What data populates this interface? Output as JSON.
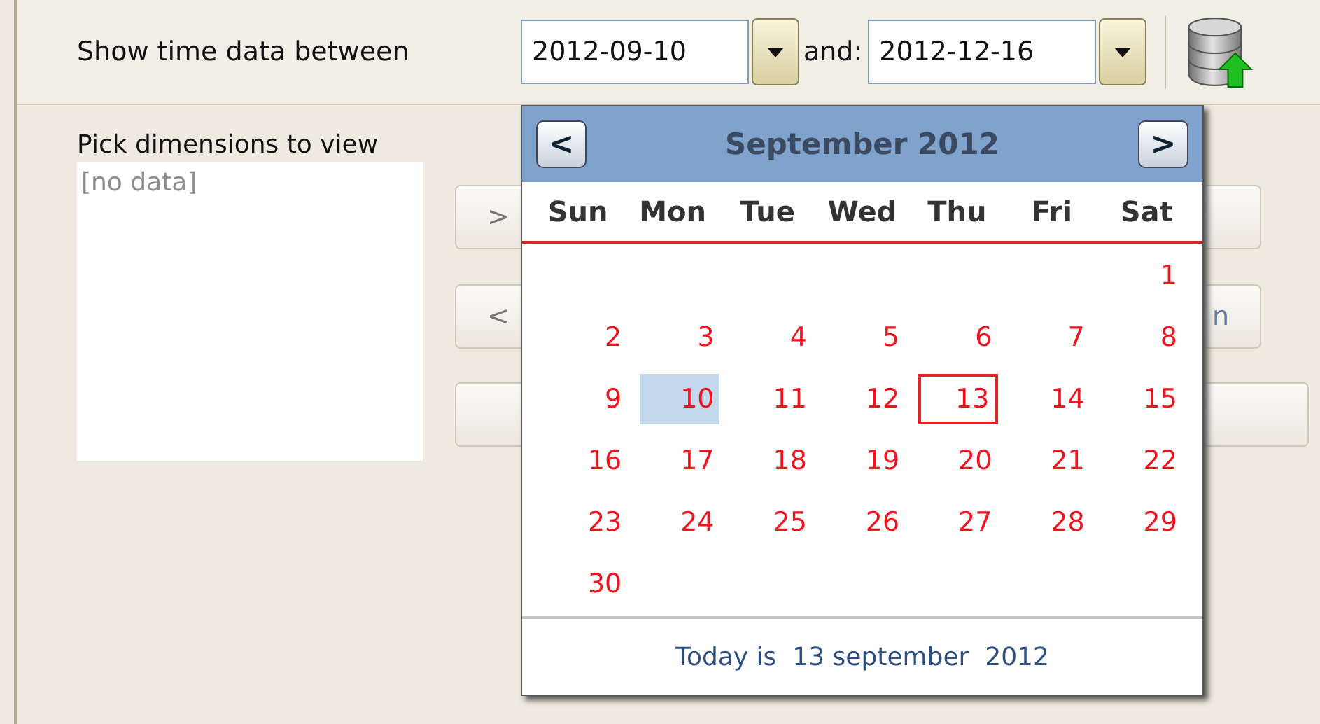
{
  "toolbar": {
    "label": "Show time data between",
    "start_date": {
      "value": "2012-09-10"
    },
    "separator": "and:",
    "end_date": {
      "value": "2012-12-16"
    }
  },
  "dimensions": {
    "label": "Pick dimensions to view",
    "list_placeholder": "[no data]"
  },
  "buttons": [
    {
      "kind": "standard",
      "label": ">"
    },
    {
      "kind": "standard",
      "label": "<",
      "trailing": "n"
    },
    {
      "kind": "shifted"
    }
  ],
  "calendar": {
    "title": "September 2012",
    "prev": "<",
    "next": ">",
    "weekdays": [
      "Sun",
      "Mon",
      "Tue",
      "Wed",
      "Thu",
      "Fri",
      "Sat"
    ],
    "weeks": [
      [
        {
          "kind": "blank"
        },
        {
          "kind": "blank"
        },
        {
          "kind": "blank"
        },
        {
          "kind": "blank"
        },
        {
          "kind": "blank"
        },
        {
          "kind": "blank"
        },
        {
          "kind": "day",
          "day": "1",
          "selected": false,
          "today": false
        }
      ],
      [
        {
          "kind": "day",
          "day": "2",
          "selected": false,
          "today": false
        },
        {
          "kind": "day",
          "day": "3",
          "selected": false,
          "today": false
        },
        {
          "kind": "day",
          "day": "4",
          "selected": false,
          "today": false
        },
        {
          "kind": "day",
          "day": "5",
          "selected": false,
          "today": false
        },
        {
          "kind": "day",
          "day": "6",
          "selected": false,
          "today": false
        },
        {
          "kind": "day",
          "day": "7",
          "selected": false,
          "today": false
        },
        {
          "kind": "day",
          "day": "8",
          "selected": false,
          "today": false
        }
      ],
      [
        {
          "kind": "day",
          "day": "9",
          "selected": false,
          "today": false
        },
        {
          "kind": "day",
          "day": "10",
          "selected": true,
          "today": false
        },
        {
          "kind": "day",
          "day": "11",
          "selected": false,
          "today": false
        },
        {
          "kind": "day",
          "day": "12",
          "selected": false,
          "today": false
        },
        {
          "kind": "day",
          "day": "13",
          "selected": false,
          "today": true
        },
        {
          "kind": "day",
          "day": "14",
          "selected": false,
          "today": false
        },
        {
          "kind": "day",
          "day": "15",
          "selected": false,
          "today": false
        }
      ],
      [
        {
          "kind": "day",
          "day": "16",
          "selected": false,
          "today": false
        },
        {
          "kind": "day",
          "day": "17",
          "selected": false,
          "today": false
        },
        {
          "kind": "day",
          "day": "18",
          "selected": false,
          "today": false
        },
        {
          "kind": "day",
          "day": "19",
          "selected": false,
          "today": false
        },
        {
          "kind": "day",
          "day": "20",
          "selected": false,
          "today": false
        },
        {
          "kind": "day",
          "day": "21",
          "selected": false,
          "today": false
        },
        {
          "kind": "day",
          "day": "22",
          "selected": false,
          "today": false
        }
      ],
      [
        {
          "kind": "day",
          "day": "23",
          "selected": false,
          "today": false
        },
        {
          "kind": "day",
          "day": "24",
          "selected": false,
          "today": false
        },
        {
          "kind": "day",
          "day": "25",
          "selected": false,
          "today": false
        },
        {
          "kind": "day",
          "day": "26",
          "selected": false,
          "today": false
        },
        {
          "kind": "day",
          "day": "27",
          "selected": false,
          "today": false
        },
        {
          "kind": "day",
          "day": "28",
          "selected": false,
          "today": false
        },
        {
          "kind": "day",
          "day": "29",
          "selected": false,
          "today": false
        }
      ],
      [
        {
          "kind": "day",
          "day": "30",
          "selected": false,
          "today": false
        },
        {
          "kind": "blank"
        },
        {
          "kind": "blank"
        },
        {
          "kind": "blank"
        },
        {
          "kind": "blank"
        },
        {
          "kind": "blank"
        },
        {
          "kind": "blank"
        }
      ]
    ],
    "footer": "Today is  13 september  2012"
  }
}
